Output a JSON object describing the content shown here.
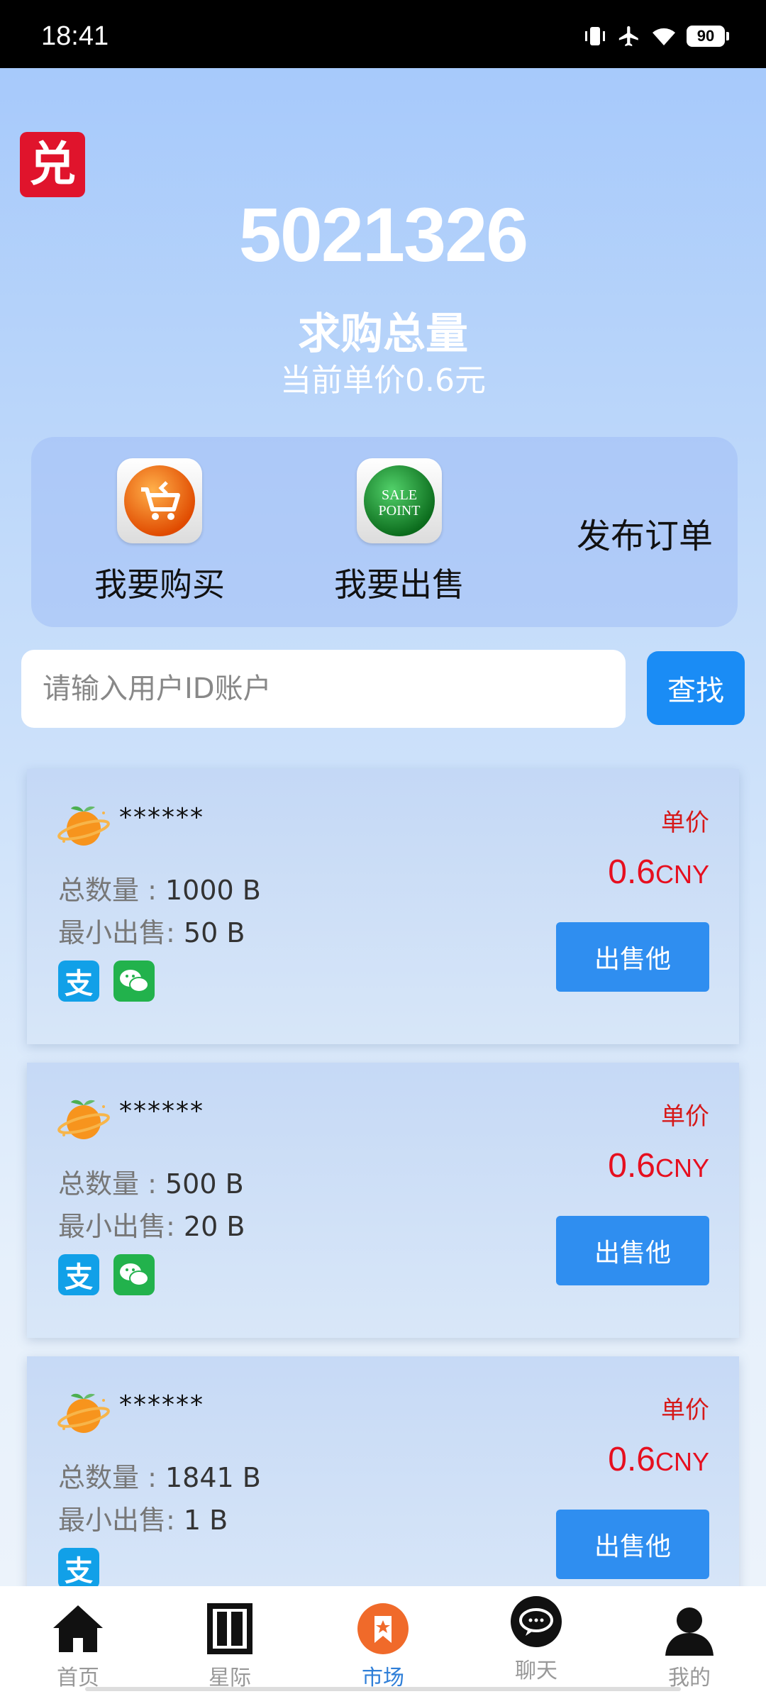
{
  "status": {
    "time": "18:41",
    "battery": "90"
  },
  "header": {
    "logo_char": "兑",
    "total_number": "5021326",
    "total_label": "求购总量",
    "current_price": "当前单价0.6元"
  },
  "actions": {
    "buy_label": "我要购买",
    "sell_label": "我要出售",
    "sell_icon_line1": "SALE",
    "sell_icon_line2": "POINT",
    "publish_label": "发布订单"
  },
  "search": {
    "placeholder": "请输入用户ID账户",
    "button_label": "查找"
  },
  "listings": [
    {
      "name": "******",
      "qty_label": "总数量 : ",
      "qty": "1000 B",
      "min_label": "最小出售: ",
      "min": "50 B",
      "unit_label": "单价",
      "price": "0.6",
      "currency": "CNY",
      "button": "出售他",
      "alipay": "支",
      "wechat": true
    },
    {
      "name": "******",
      "qty_label": "总数量 : ",
      "qty": "500 B",
      "min_label": "最小出售: ",
      "min": "20 B",
      "unit_label": "单价",
      "price": "0.6",
      "currency": "CNY",
      "button": "出售他",
      "alipay": "支",
      "wechat": true
    },
    {
      "name": "******",
      "qty_label": "总数量 : ",
      "qty": "1841 B",
      "min_label": "最小出售: ",
      "min": "1 B",
      "unit_label": "单价",
      "price": "0.6",
      "currency": "CNY",
      "button": "出售他",
      "alipay": "支",
      "wechat": false
    }
  ],
  "tabs": [
    {
      "label": "首页",
      "icon": "home-icon"
    },
    {
      "label": "星际",
      "icon": "door-icon"
    },
    {
      "label": "市场",
      "icon": "market-icon",
      "active": true
    },
    {
      "label": "聊天",
      "icon": "chat-icon"
    },
    {
      "label": "我的",
      "icon": "user-icon"
    }
  ],
  "colors": {
    "accent": "#1a8cf5",
    "price_red": "#e60f1f",
    "active_tab": "#2f7fd8"
  }
}
